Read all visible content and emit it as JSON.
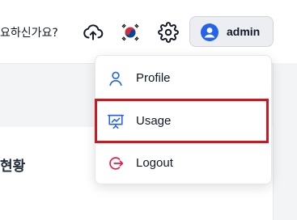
{
  "header": {
    "help_text": "요하신가요?",
    "admin_label": "admin"
  },
  "icons": {
    "upload": "cloud-upload-icon",
    "language": "korean-flag-icon",
    "settings": "gear-icon",
    "avatar": "user-avatar-icon"
  },
  "content": {
    "title": "현황"
  },
  "dropdown": {
    "items": [
      {
        "label": "Profile",
        "icon": "user-icon"
      },
      {
        "label": "Usage",
        "icon": "presentation-chart-icon",
        "highlighted": true
      },
      {
        "label": "Logout",
        "icon": "logout-icon"
      }
    ]
  },
  "colors": {
    "accent_blue": "#2563eb",
    "logout_red": "#e11d48",
    "highlight_red": "#d0161e"
  }
}
